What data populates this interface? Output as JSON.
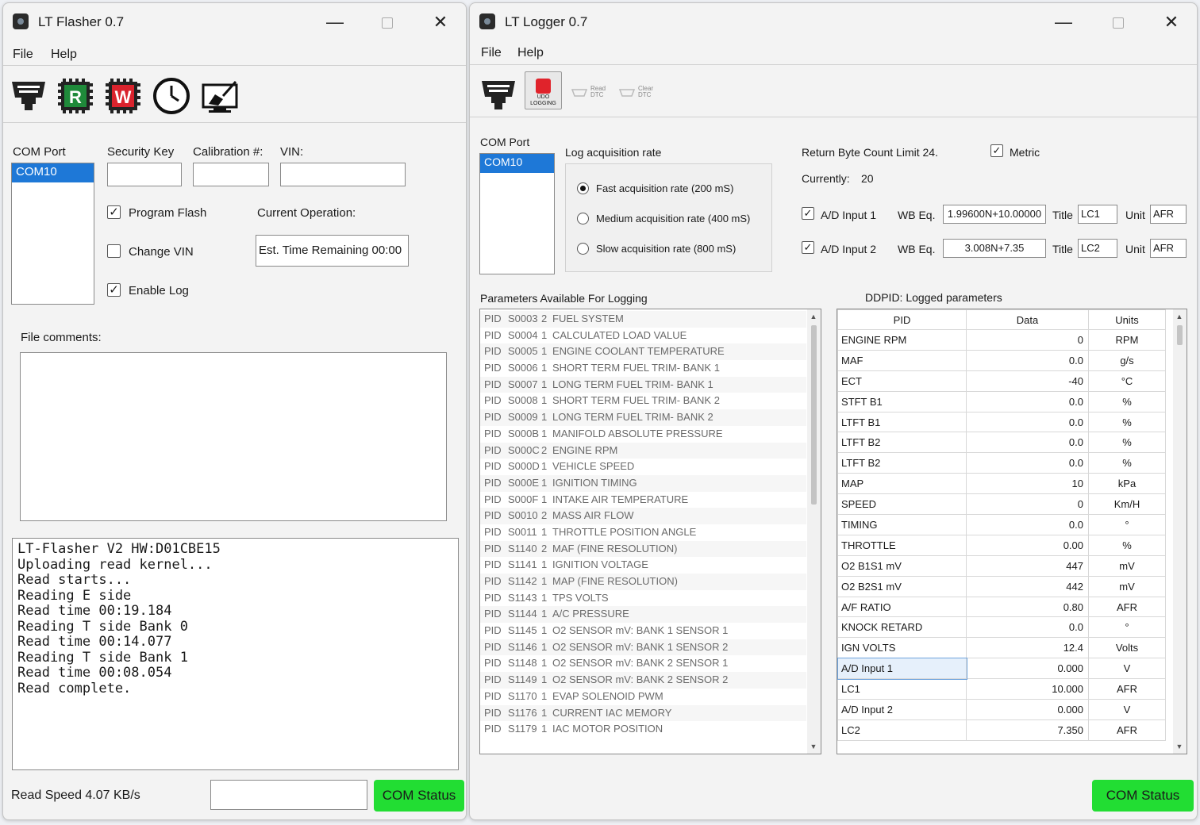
{
  "flasher": {
    "title": "LT Flasher 0.7",
    "menu": [
      "File",
      "Help"
    ],
    "toolbar": {
      "r_label": "R",
      "w_label": "W"
    },
    "com_port_label": "COM Port",
    "com_port_selected": "COM10",
    "security_key_label": "Security Key",
    "calibration_label": "Calibration #:",
    "vin_label": "VIN:",
    "program_flash_label": "Program Flash",
    "change_vin_label": "Change VIN",
    "enable_log_label": "Enable Log",
    "program_flash_checked": true,
    "change_vin_checked": false,
    "enable_log_checked": true,
    "current_operation_label": "Current Operation:",
    "est_time": "Est. Time Remaining 00:00",
    "file_comments_label": "File comments:",
    "console_lines": [
      "LT-Flasher V2 HW:D01CBE15",
      "Uploading read kernel...",
      "Read starts...",
      "Reading E side",
      "Read time 00:19.184",
      "Reading T side Bank 0",
      "Read time 00:14.077",
      "Reading T side Bank 1",
      "Read time 00:08.054",
      "Read complete."
    ],
    "read_speed": "Read Speed 4.07 KB/s",
    "com_status": "COM Status"
  },
  "logger": {
    "title": "LT Logger 0.7",
    "menu": [
      "File",
      "Help"
    ],
    "toolbar": {
      "stop_top": "UDO",
      "stop_bottom": "LOGGING",
      "read_dtc_top": "Read",
      "read_dtc_bottom": "DTC",
      "clear_dtc_top": "Clear",
      "clear_dtc_bottom": "DTC"
    },
    "com_port_label": "COM Port",
    "com_port_selected": "COM10",
    "log_rate_label": "Log acquisition rate",
    "rates": [
      {
        "label": "Fast acquisition rate (200 mS)",
        "selected": true
      },
      {
        "label": "Medium acquisition rate (400 mS)",
        "selected": false
      },
      {
        "label": "Slow acquisition rate (800 mS)",
        "selected": false
      }
    ],
    "return_byte_label": "Return Byte Count Limit 24.",
    "metric_label": "Metric",
    "metric_checked": true,
    "currently_label": "Currently:",
    "currently_value": "20",
    "ad1": {
      "label": "A/D Input 1",
      "checked": true,
      "wb_label": "WB Eq.",
      "wb_value": "1.99600N+10.00000",
      "title_label": "Title",
      "title_value": "LC1",
      "unit_label": "Unit",
      "unit_value": "AFR"
    },
    "ad2": {
      "label": "A/D Input 2",
      "checked": true,
      "wb_label": "WB Eq.",
      "wb_value": "3.008N+7.35",
      "title_label": "Title",
      "title_value": "LC2",
      "unit_label": "Unit",
      "unit_value": "AFR"
    },
    "params_label": "Parameters Available For Logging",
    "params": [
      [
        "PID",
        "S0003",
        "2",
        "FUEL SYSTEM"
      ],
      [
        "PID",
        "S0004",
        "1",
        "CALCULATED LOAD VALUE"
      ],
      [
        "PID",
        "S0005",
        "1",
        "ENGINE COOLANT TEMPERATURE"
      ],
      [
        "PID",
        "S0006",
        "1",
        "SHORT TERM FUEL TRIM- BANK 1"
      ],
      [
        "PID",
        "S0007",
        "1",
        "LONG TERM FUEL TRIM- BANK 1"
      ],
      [
        "PID",
        "S0008",
        "1",
        "SHORT TERM FUEL TRIM- BANK 2"
      ],
      [
        "PID",
        "S0009",
        "1",
        "LONG TERM FUEL TRIM- BANK 2"
      ],
      [
        "PID",
        "S000B",
        "1",
        "MANIFOLD ABSOLUTE PRESSURE"
      ],
      [
        "PID",
        "S000C",
        "2",
        "ENGINE RPM"
      ],
      [
        "PID",
        "S000D",
        "1",
        "VEHICLE SPEED"
      ],
      [
        "PID",
        "S000E",
        "1",
        "IGNITION TIMING"
      ],
      [
        "PID",
        "S000F",
        "1",
        "INTAKE AIR TEMPERATURE"
      ],
      [
        "PID",
        "S0010",
        "2",
        "MASS AIR FLOW"
      ],
      [
        "PID",
        "S0011",
        "1",
        "THROTTLE POSITION ANGLE"
      ],
      [
        "PID",
        "S1140",
        "2",
        "MAF (FINE RESOLUTION)"
      ],
      [
        "PID",
        "S1141",
        "1",
        "IGNITION VOLTAGE"
      ],
      [
        "PID",
        "S1142",
        "1",
        "MAP (FINE RESOLUTION)"
      ],
      [
        "PID",
        "S1143",
        "1",
        "TPS VOLTS"
      ],
      [
        "PID",
        "S1144",
        "1",
        "A/C PRESSURE"
      ],
      [
        "PID",
        "S1145",
        "1",
        "O2 SENSOR mV: BANK 1 SENSOR 1"
      ],
      [
        "PID",
        "S1146",
        "1",
        "O2 SENSOR mV: BANK 1 SENSOR 2"
      ],
      [
        "PID",
        "S1148",
        "1",
        "O2 SENSOR mV: BANK 2 SENSOR 1"
      ],
      [
        "PID",
        "S1149",
        "1",
        "O2 SENSOR mV: BANK 2 SENSOR 2"
      ],
      [
        "PID",
        "S1170",
        "1",
        "EVAP SOLENOID PWM"
      ],
      [
        "PID",
        "S1176",
        "1",
        "CURRENT IAC MEMORY"
      ],
      [
        "PID",
        "S1179",
        "1",
        "IAC MOTOR POSITION"
      ]
    ],
    "ddpid_label": "DDPID: Logged parameters",
    "table_headers": [
      "PID",
      "Data",
      "Units"
    ],
    "logged": [
      [
        "ENGINE RPM",
        "0",
        "RPM"
      ],
      [
        "MAF",
        "0.0",
        "g/s"
      ],
      [
        "ECT",
        "-40",
        "°C"
      ],
      [
        "STFT B1",
        "0.0",
        "%"
      ],
      [
        "LTFT B1",
        "0.0",
        "%"
      ],
      [
        "LTFT B2",
        "0.0",
        "%"
      ],
      [
        "LTFT B2",
        "0.0",
        "%"
      ],
      [
        "MAP",
        "10",
        "kPa"
      ],
      [
        "SPEED",
        "0",
        "Km/H"
      ],
      [
        "TIMING",
        "0.0",
        "°"
      ],
      [
        "THROTTLE",
        "0.00",
        "%"
      ],
      [
        "O2 B1S1 mV",
        "447",
        "mV"
      ],
      [
        "O2 B2S1 mV",
        "442",
        "mV"
      ],
      [
        "A/F RATIO",
        "0.80",
        "AFR"
      ],
      [
        "KNOCK RETARD",
        "0.0",
        "°"
      ],
      [
        "IGN VOLTS",
        "12.4",
        "Volts"
      ],
      [
        "A/D Input 1",
        "0.000",
        "V"
      ],
      [
        "LC1",
        "10.000",
        "AFR"
      ],
      [
        "A/D Input 2",
        "0.000",
        "V"
      ],
      [
        "LC2",
        "7.350",
        "AFR"
      ]
    ],
    "com_status": "COM Status"
  }
}
